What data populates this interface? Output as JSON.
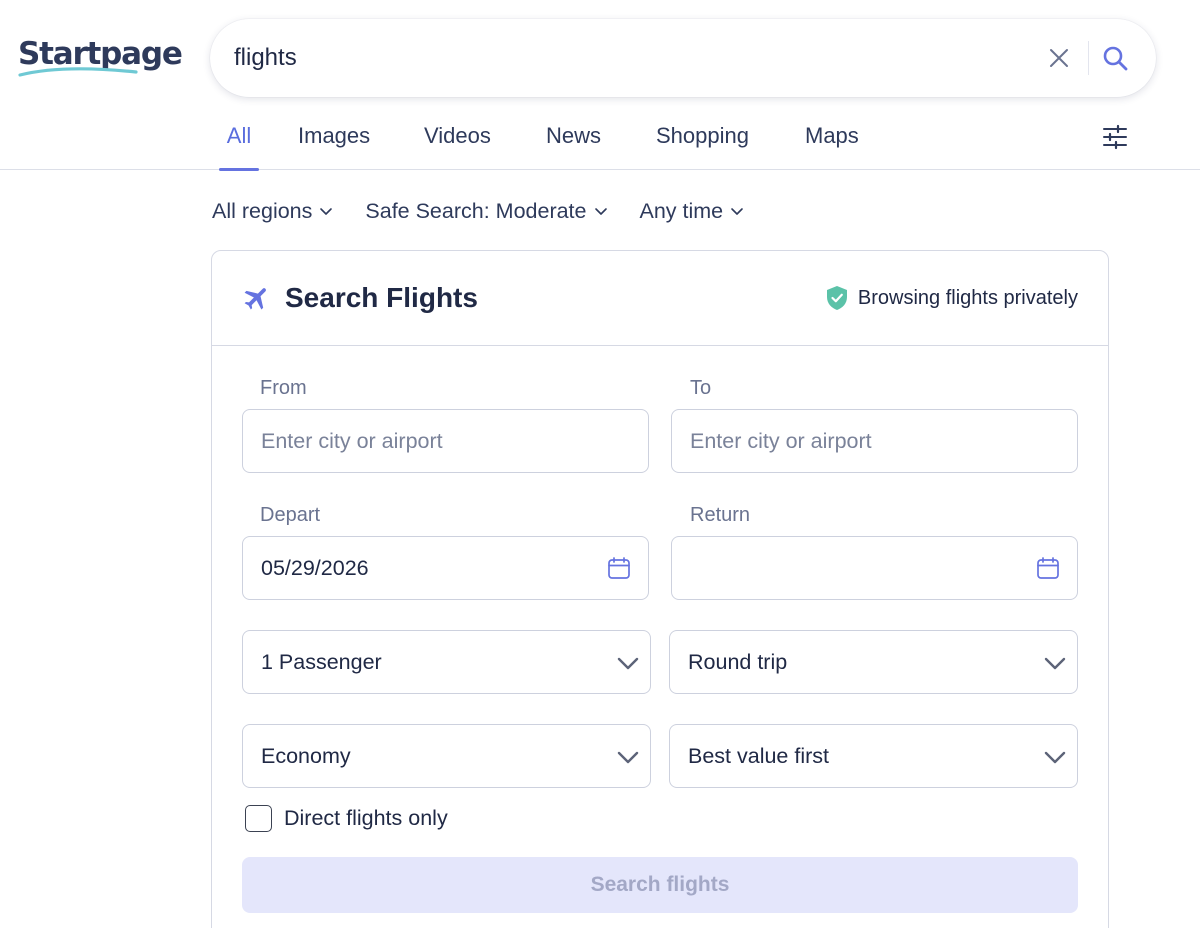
{
  "header": {
    "logo_text": "Startpage",
    "search": {
      "value": "flights"
    }
  },
  "tabs": [
    {
      "label": "All",
      "active": true
    },
    {
      "label": "Images",
      "active": false
    },
    {
      "label": "Videos",
      "active": false
    },
    {
      "label": "News",
      "active": false
    },
    {
      "label": "Shopping",
      "active": false
    },
    {
      "label": "Maps",
      "active": false
    }
  ],
  "filters": {
    "region": "All regions",
    "safe_search": "Safe Search: Moderate",
    "time": "Any time"
  },
  "flight_widget": {
    "title": "Search Flights",
    "privacy_text": "Browsing flights privately",
    "from": {
      "label": "From",
      "placeholder": "Enter city or airport",
      "value": ""
    },
    "to": {
      "label": "To",
      "placeholder": "Enter city or airport",
      "value": ""
    },
    "depart": {
      "label": "Depart",
      "value": "05/29/2026"
    },
    "return": {
      "label": "Return",
      "value": ""
    },
    "passengers": {
      "selected": "1 Passenger"
    },
    "trip_type": {
      "selected": "Round trip"
    },
    "cabin_class": {
      "selected": "Economy"
    },
    "sort": {
      "selected": "Best value first"
    },
    "direct_only": {
      "label": "Direct flights only",
      "checked": false
    },
    "submit_label": "Search flights"
  },
  "colors": {
    "accent": "#6573e0",
    "text": "#202945",
    "muted": "#6a7390",
    "border": "#cdd1de",
    "shield": "#5bc2a8",
    "button_bg": "#e4e6fb",
    "button_text": "#a3a8c6"
  },
  "icons": {
    "clear": "close-icon",
    "search": "search-icon",
    "settings": "sliders-icon",
    "plane": "airplane-icon",
    "privacy": "shield-check-icon",
    "calendar": "calendar-icon",
    "dropdown": "chevron-down-icon"
  }
}
